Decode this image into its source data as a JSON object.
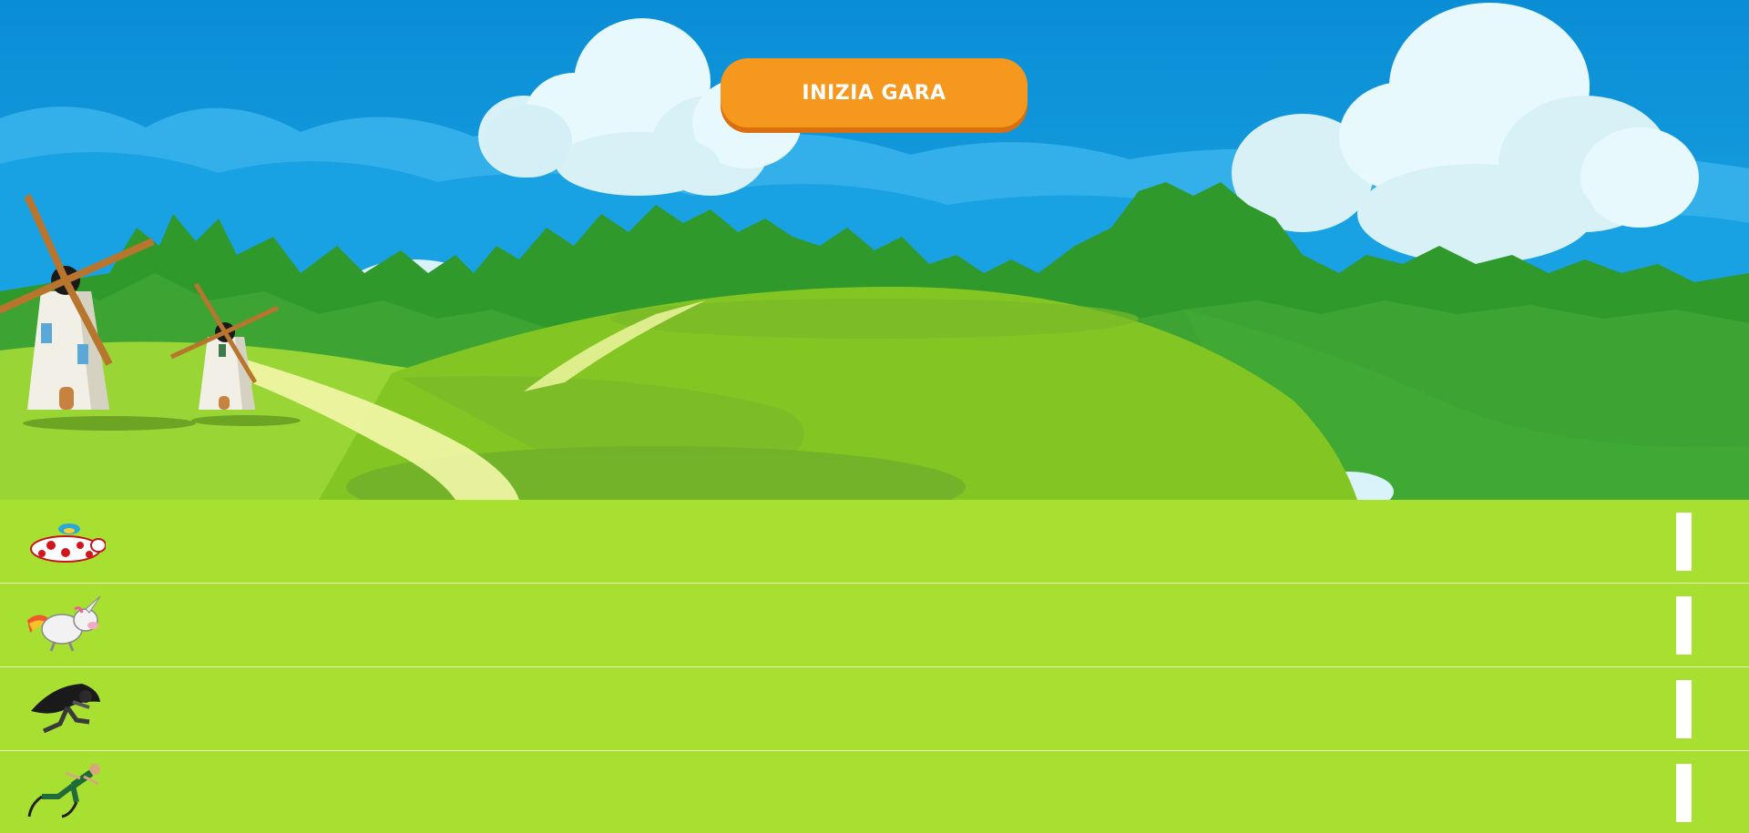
{
  "header": {
    "start_button_label": "INIZIA GARA"
  },
  "colors": {
    "sky": "#0a8fd6",
    "grass": "#a8e032",
    "button": "#f7981e",
    "forest": "#2f9a2b"
  },
  "track": {
    "lanes": [
      {
        "racer_icon": "spotted-cow-icon"
      },
      {
        "racer_icon": "unicorn-icon"
      },
      {
        "racer_icon": "dark-hero-runner-icon"
      },
      {
        "racer_icon": "blade-runner-icon"
      }
    ]
  }
}
